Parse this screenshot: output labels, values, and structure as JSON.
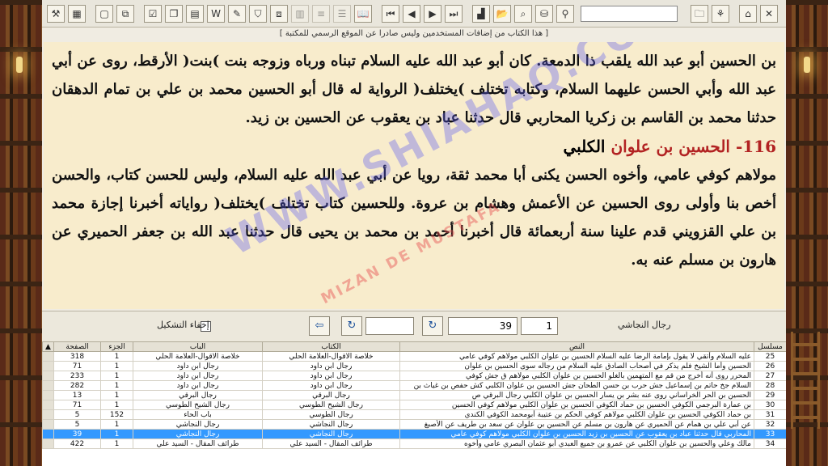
{
  "notice": "[ هذا الكتاب من إضافات المستخدمين وليس صادرا عن الموقع الرسمي للمكتبة ]",
  "reader": {
    "para1": "بن الحسين أبو عبد الله يلقب ذا الدمعة. كان أبو عبد الله عليه السلام تبناه ورباه وزوجه بنت )بنت( الأرقط، روى عن أبي عبد الله وأبي الحسن عليهما السلام، وكتابه تختلف )يختلف( الرواية له قال أبو الحسين محمد بن علي بن تمام الدهقان حدثنا محمد بن القاسم بن زكريا المحاربي قال حدثنا عباد بن يعقوب عن الحسين بن زيد.",
    "heading_num": "116-",
    "heading_name": "الحسين بن علوان",
    "heading_rest": "الكلبي",
    "para2": "مولاهم كوفي عامي، وأخوه الحسن يكنى أبا محمد ثقة، رويا عن أبي عبد الله عليه السلام، وليس للحسن كتاب، والحسن أخص بنا وأولى روى الحسين عن الأعمش وهشام بن عروة. وللحسين كتاب تختلف )يختلف( رواياته أخبرنا إجازة محمد بن علي القزويني قدم علينا سنة أربعمائة قال أخبرنا أحمد بن محمد بن يحيى قال حدثنا عبد الله بن جعفر الحميري عن هارون بن مسلم عنه به.",
    "watermark": "WWW.SHIAHAQ.COM",
    "watermark2": "MIZAN DE MUSTAFA"
  },
  "navstrip": {
    "book_label": "رجال النجاشي",
    "page_value": "1",
    "part_value": "39",
    "hide_diacritics_label": "إخفاء التشكيل"
  },
  "grid": {
    "headers": {
      "serial": "مسلسل",
      "text": "النص",
      "book": "الكتاب",
      "chapter": "الباب",
      "part": "الجزء",
      "page": "الصفحة"
    },
    "rows": [
      {
        "serial": "25",
        "text": "عليه السلام وأتقي لا يقول بإمامة الرضا عليه السلام الحسين بن علوان الكلبي مولاهم كوفي عامي",
        "book": "خلاصة الاقوال-العلامة الحلي",
        "chapter": "خلاصة الاقوال-العلامة الحلي",
        "part": "1",
        "page": "318"
      },
      {
        "serial": "26",
        "text": "الحسين وأما الشيخ فلم يذكر في أصحاب الصادق عليه السلام من رجاله سوى الحسين بن علوان",
        "book": "رجال ابن داود",
        "chapter": "رجال ابن داود",
        "part": "1",
        "page": "71"
      },
      {
        "serial": "27",
        "text": "المحرر روى أنه أخرج من قم مع المتهمين بالغلو الحسين بن علوان الكلبي مولاهم ق جش كوفي",
        "book": "رجال ابن داود",
        "chapter": "رجال ابن داود",
        "part": "1",
        "page": "233"
      },
      {
        "serial": "28",
        "text": "السلام جخ حاتم بن إسماعيل جش حرب بن حسن الطحان جش الحسين بن علوان الكلبي كش حفص بن غياث بن",
        "book": "رجال ابن داود",
        "chapter": "رجال ابن داود",
        "part": "1",
        "page": "282"
      },
      {
        "serial": "29",
        "text": "الحسين بن الحر الخراساني روى عنه بشر بن يسار الحسين بن علوان الكلبي رجال البرقي ص",
        "book": "رجال البرقي",
        "chapter": "رجال البرقي",
        "part": "1",
        "page": "13"
      },
      {
        "serial": "30",
        "text": "بن عمارة البرجمي الكوفي الحسين بن حماد الكوفي الحسين بن علوان الكلبي مولاهم كوفي الحسين",
        "book": "رجال الشيخ الطوسي",
        "chapter": "رجال الشيخ الطوسي",
        "part": "1",
        "page": "71"
      },
      {
        "serial": "31",
        "text": "بن حماد الكوفي الحسين بن علوان الكلبي مولاهم كوفي الحكم بن عتيبة أبومحمد الكوفي الكندي",
        "book": "رجال الطوسي",
        "chapter": "باب الحاء",
        "part": "152",
        "page": "5"
      },
      {
        "serial": "32",
        "text": "عن أبي علي بن همام عن الحميري عن هارون بن مسلم عن الحسين بن علوان عن سعد بن طريف عن الأصبغ",
        "book": "رجال النجاشي",
        "chapter": "رجال النجاشي",
        "part": "1",
        "page": "5"
      },
      {
        "serial": "33",
        "text": "المحاربي قال حدثنا عباد بن يعقوب عن الحسين بن زيد الحسين بن علوان الكلبي مولاهم كوفي عامي",
        "book": "رجال النجاشي",
        "chapter": "رجال النجاشي",
        "part": "1",
        "page": "39",
        "selected": true
      },
      {
        "serial": "34",
        "text": "مالك وعلي والحسين بن علوان الكلبي عن عمرو بن جميع العبدي أبو عثمان البصري عامي وأخوه",
        "book": "طرائف المقال - السيد علي",
        "chapter": "طرائف المقال - السيد علي",
        "part": "1",
        "page": "422"
      }
    ]
  },
  "colors": {
    "reader_bg": "#f8eccc",
    "heading_red": "#b22222",
    "selected_row": "#3399ff"
  }
}
